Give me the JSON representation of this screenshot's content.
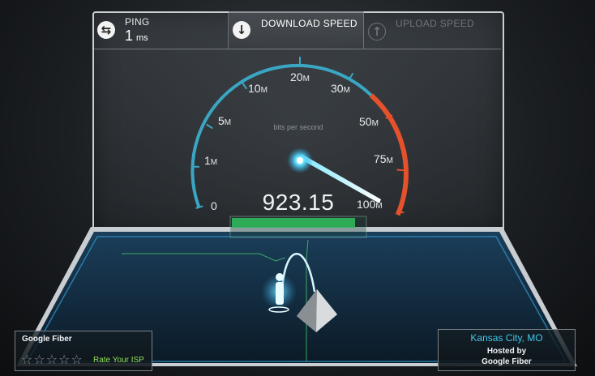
{
  "topbar": {
    "ping_label": "PING",
    "ping_value": "1",
    "ping_unit": "ms",
    "download_label": "DOWNLOAD SPEED",
    "upload_label": "UPLOAD SPEED",
    "ping_icon": "swap-arrows-icon",
    "download_icon": "arrow-down-icon",
    "upload_icon": "arrow-up-icon"
  },
  "gauge": {
    "unit_caption": "bits per second",
    "current_value": "923.15",
    "ticks": [
      {
        "num": "0",
        "suffix": ""
      },
      {
        "num": "1",
        "suffix": "M"
      },
      {
        "num": "5",
        "suffix": "M"
      },
      {
        "num": "10",
        "suffix": "M"
      },
      {
        "num": "20",
        "suffix": "M"
      },
      {
        "num": "30",
        "suffix": "M"
      },
      {
        "num": "50",
        "suffix": "M"
      },
      {
        "num": "75",
        "suffix": "M"
      },
      {
        "num": "100",
        "suffix": "M"
      }
    ],
    "colors": {
      "arc_normal": "#3aa6c4",
      "arc_high": "#e4512b",
      "progress": "#2fb85a",
      "readout": "#f0f2f3"
    }
  },
  "isp_panel": {
    "name": "Google Fiber",
    "rate_label": "Rate Your ISP",
    "stars": [
      "☆",
      "☆",
      "☆",
      "☆",
      "☆"
    ]
  },
  "server_panel": {
    "city": "Kansas City, MO",
    "hosted_line1": "Hosted by",
    "hosted_line2": "Google Fiber"
  }
}
